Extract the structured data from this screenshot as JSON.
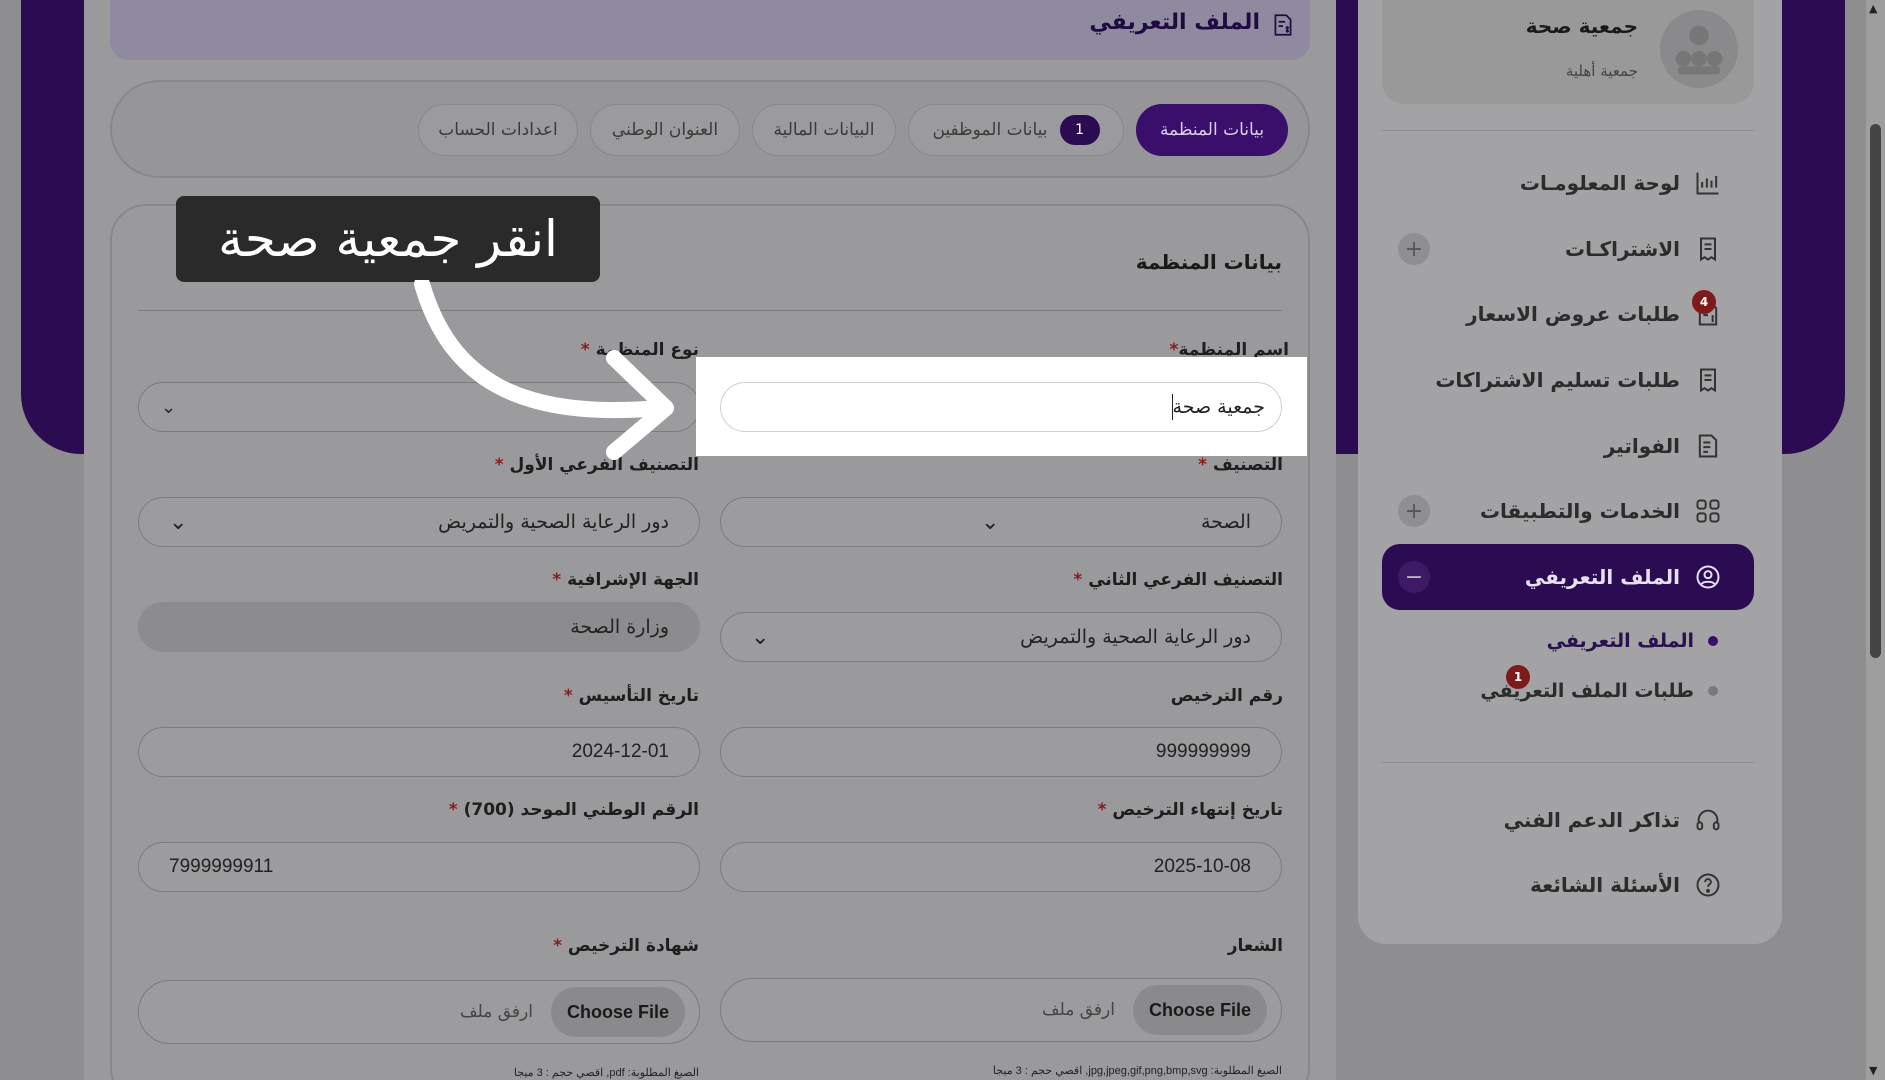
{
  "header": {
    "title": "الملف التعريفي",
    "icon": "document-dollar-icon"
  },
  "tabs": [
    {
      "label": "بيانات المنظمة",
      "active": true
    },
    {
      "label": "بيانات الموظفين",
      "badge": "1"
    },
    {
      "label": "البيانات المالية"
    },
    {
      "label": "العنوان الوطني"
    },
    {
      "label": "اعدادات الحساب"
    }
  ],
  "card": {
    "title": "بيانات المنظمة"
  },
  "fields": {
    "org_name": {
      "label": "اسم المنظمة",
      "req": "*",
      "value": "جمعية صحة"
    },
    "org_type": {
      "label": "نوع المنظمة",
      "req": "*",
      "value": ""
    },
    "classification": {
      "label": "التصنيف",
      "req": "*",
      "value": "الصحة"
    },
    "sub1": {
      "label": "التصنيف الفرعي الأول",
      "req": "*",
      "value": "دور الرعاية الصحية والتمريض"
    },
    "sub2": {
      "label": "التصنيف الفرعي الثاني",
      "req": "*",
      "value": "دور الرعاية الصحية والتمريض"
    },
    "supervisor": {
      "label": "الجهة الإشرافية",
      "req": "*",
      "value": "وزارة الصحة"
    },
    "license_no": {
      "label": "رقم الترخيص",
      "value": "999999999"
    },
    "founded": {
      "label": "تاريخ التأسيس",
      "req": "*",
      "value": "2024-12-01"
    },
    "license_end": {
      "label": "تاريخ إنتهاء الترخيص",
      "req": "*",
      "value": "2025-10-08"
    },
    "unified_no": {
      "label": "الرقم الوطني الموحد (700)",
      "req": "*",
      "value": "7999999911"
    },
    "logo": {
      "label": "الشعار",
      "button": "Choose File",
      "placeholder": "ارفق ملف",
      "note": "الصيغ المطلوبة: jpg,jpeg,gif,png,bmp,svg, اقصي حجم : 3 ميجا"
    },
    "license_cert": {
      "label": "شهادة الترخيص",
      "req": "*",
      "button": "Choose File",
      "placeholder": "ارفق ملف",
      "note": "الصيغ المطلوبة: pdf, اقصي حجم : 3 ميجا"
    }
  },
  "callout": {
    "text": "انقر جمعية صحة"
  },
  "sidebar": {
    "org_name": "جمعية صحة",
    "org_type": "جمعية أهلية",
    "items": [
      {
        "label": "لوحة المعلومـات",
        "icon": "chart-icon"
      },
      {
        "label": "الاشتراكـات",
        "icon": "receipt-icon",
        "expand": "+"
      },
      {
        "label": "طلبات عروض الاسعار",
        "icon": "document-dollar-icon",
        "badge": "4"
      },
      {
        "label": "طلبات تسليم الاشتراكات",
        "icon": "receipt-icon"
      },
      {
        "label": "الفواتير",
        "icon": "invoice-icon"
      },
      {
        "label": "الخدمات والتطبيقات",
        "icon": "grid-icon",
        "expand": "+"
      },
      {
        "label": "الملف التعريفي",
        "icon": "user-circle-icon",
        "expand": "−",
        "active": true
      },
      {
        "label": "الملف التعريفي",
        "sub": true
      },
      {
        "label": "طلبات الملف التعريفي",
        "sub": true,
        "badge": "1"
      },
      {
        "label": "تذاكر الدعم الفني",
        "icon": "headset-icon"
      },
      {
        "label": "الأسئلة الشائعة",
        "icon": "question-icon"
      }
    ]
  },
  "colors": {
    "brand": "#3a0f6c",
    "overlay": "#000000",
    "badge": "#7e1a1a"
  }
}
